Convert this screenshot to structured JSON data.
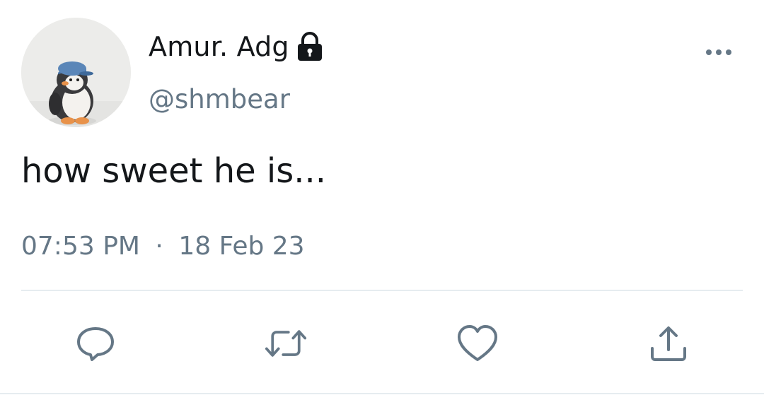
{
  "user": {
    "display_name": "Amur. Adg",
    "handle": "@shmbear",
    "avatar_icon": "penguin-plush-avatar",
    "protected_icon": "lock-icon"
  },
  "tweet": {
    "text": "how sweet he is...",
    "time": "07:53 PM",
    "separator": "·",
    "date": "18 Feb 23"
  },
  "actions": {
    "reply_icon": "reply-icon",
    "retweet_icon": "retweet-icon",
    "like_icon": "like-icon",
    "share_icon": "share-icon",
    "more_icon": "more-icon"
  },
  "colors": {
    "text_primary": "#14171a",
    "text_secondary": "#657786",
    "icon": "#657786",
    "divider": "#e6ecf0"
  }
}
